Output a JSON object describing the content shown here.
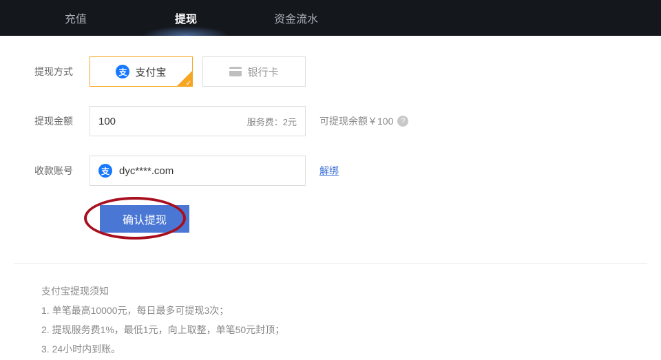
{
  "tabs": {
    "deposit": "充值",
    "withdraw": "提现",
    "ledger": "资金流水"
  },
  "labels": {
    "method": "提现方式",
    "amount": "提现金额",
    "account": "收款账号"
  },
  "methods": {
    "alipay": "支付宝",
    "bank": "银行卡",
    "alipay_badge": "支"
  },
  "amount": {
    "value": "100",
    "fee": "服务费：2元",
    "balance": "可提现余额￥100"
  },
  "account": {
    "value": "dyc****.com",
    "unbind": "解绑"
  },
  "submit": "确认提现",
  "notice": {
    "title": "支付宝提现须知",
    "r1": "1. 单笔最高10000元，每日最多可提现3次；",
    "r2": "2. 提现服务费1%，最低1元，向上取整，单笔50元封顶；",
    "r3": "3. 24小时内到账。"
  }
}
